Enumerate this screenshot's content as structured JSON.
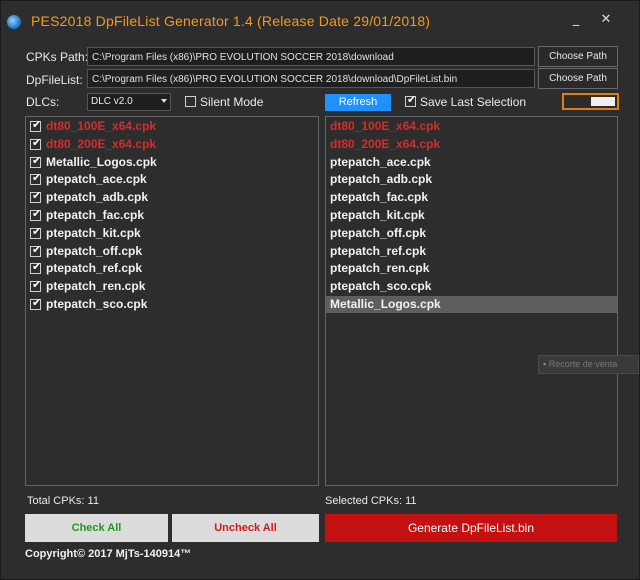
{
  "window": {
    "title": "PES2018 DpFileList Generator 1.4 (Release Date 29/01/2018)",
    "minimize_glyph": "_",
    "close_glyph": "✕"
  },
  "paths": {
    "cpks_label": "CPKs Path:",
    "cpks_value": "C:\\Program Files (x86)\\PRO EVOLUTION SOCCER 2018\\download",
    "dpfilelist_label": "DpFileList:",
    "dpfilelist_value": "C:\\Program Files (x86)\\PRO EVOLUTION SOCCER 2018\\download\\DpFileList.bin",
    "choose_label": "Choose Path"
  },
  "options": {
    "dlcs_label": "DLCs:",
    "dlc_selected": "DLC v2.0",
    "silent_mode_label": "Silent Mode",
    "silent_mode_checked": false,
    "refresh_label": "Refresh",
    "save_last_label": "Save Last Selection",
    "save_last_checked": true,
    "toggle_on": true
  },
  "colors": {
    "accent_orange": "#f39a1e",
    "refresh_blue": "#1e90ff",
    "generate_red": "#c41010",
    "dlc_red": "#d32d2d",
    "check_green": "#1f9a1f"
  },
  "left_list": [
    {
      "name": "dt80_100E_x64.cpk",
      "checked": true,
      "dlc": true
    },
    {
      "name": "dt80_200E_x64.cpk",
      "checked": true,
      "dlc": true
    },
    {
      "name": "Metallic_Logos.cpk",
      "checked": true,
      "dlc": false
    },
    {
      "name": "ptepatch_ace.cpk",
      "checked": true,
      "dlc": false
    },
    {
      "name": "ptepatch_adb.cpk",
      "checked": true,
      "dlc": false
    },
    {
      "name": "ptepatch_fac.cpk",
      "checked": true,
      "dlc": false
    },
    {
      "name": "ptepatch_kit.cpk",
      "checked": true,
      "dlc": false
    },
    {
      "name": "ptepatch_off.cpk",
      "checked": true,
      "dlc": false
    },
    {
      "name": "ptepatch_ref.cpk",
      "checked": true,
      "dlc": false
    },
    {
      "name": "ptepatch_ren.cpk",
      "checked": true,
      "dlc": false
    },
    {
      "name": "ptepatch_sco.cpk",
      "checked": true,
      "dlc": false
    }
  ],
  "right_list": [
    {
      "name": "dt80_100E_x64.cpk",
      "dlc": true,
      "selected": false
    },
    {
      "name": "dt80_200E_x64.cpk",
      "dlc": true,
      "selected": false
    },
    {
      "name": "ptepatch_ace.cpk",
      "dlc": false,
      "selected": false
    },
    {
      "name": "ptepatch_adb.cpk",
      "dlc": false,
      "selected": false
    },
    {
      "name": "ptepatch_fac.cpk",
      "dlc": false,
      "selected": false
    },
    {
      "name": "ptepatch_kit.cpk",
      "dlc": false,
      "selected": false
    },
    {
      "name": "ptepatch_off.cpk",
      "dlc": false,
      "selected": false
    },
    {
      "name": "ptepatch_ref.cpk",
      "dlc": false,
      "selected": false
    },
    {
      "name": "ptepatch_ren.cpk",
      "dlc": false,
      "selected": false
    },
    {
      "name": "ptepatch_sco.cpk",
      "dlc": false,
      "selected": false
    },
    {
      "name": "Metallic_Logos.cpk",
      "dlc": false,
      "selected": true
    }
  ],
  "ghost_tooltip": "Recorte de venta",
  "footer": {
    "total_cpks": "Total CPKs: 11",
    "selected_cpks": "Selected CPKs: 11",
    "check_all": "Check All",
    "uncheck_all": "Uncheck All",
    "generate": "Generate DpFileList.bin",
    "copyright": "Copyright©  2017 MjTs-140914™"
  }
}
